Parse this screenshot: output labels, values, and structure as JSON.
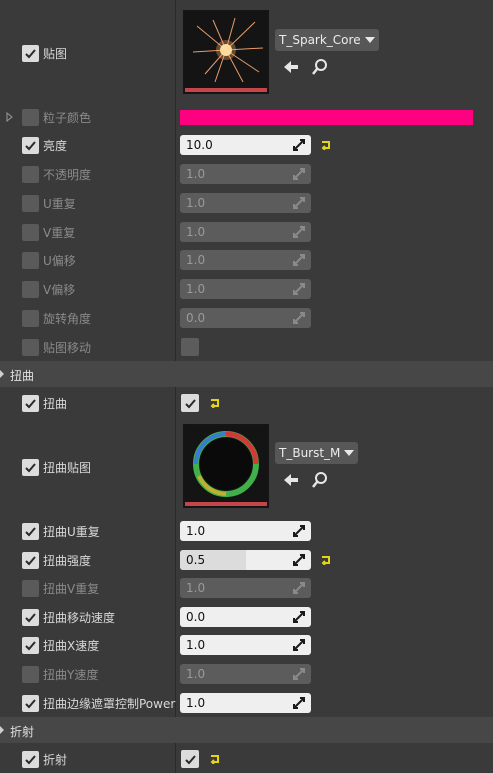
{
  "texture": {
    "label": "贴图",
    "asset": "T_Spark_Core"
  },
  "particle_color": {
    "label": "粒子颜色",
    "color": "#ff0080"
  },
  "brightness": {
    "label": "亮度",
    "value": "10.0"
  },
  "opacity": {
    "label": "不透明度",
    "value": "1.0"
  },
  "u_repeat": {
    "label": "U重复",
    "value": "1.0"
  },
  "v_repeat": {
    "label": "V重复",
    "value": "1.0"
  },
  "u_offset": {
    "label": "U偏移",
    "value": "1.0"
  },
  "v_offset": {
    "label": "V偏移",
    "value": "1.0"
  },
  "rotation": {
    "label": "旋转角度",
    "value": "0.0"
  },
  "texture_move": {
    "label": "贴图移动"
  },
  "distortion_section": {
    "label": "扭曲"
  },
  "distortion": {
    "label": "扭曲"
  },
  "distortion_texture": {
    "label": "扭曲贴图",
    "asset": "T_Burst_M"
  },
  "distortion_u_repeat": {
    "label": "扭曲U重复",
    "value": "1.0"
  },
  "distortion_strength": {
    "label": "扭曲强度",
    "value": "0.5",
    "fill": 0.5
  },
  "distortion_v_repeat": {
    "label": "扭曲V重复",
    "value": "1.0"
  },
  "distortion_move_speed": {
    "label": "扭曲移动速度",
    "value": "0.0"
  },
  "distortion_x_speed": {
    "label": "扭曲X速度",
    "value": "1.0"
  },
  "distortion_y_speed": {
    "label": "扭曲Y速度",
    "value": "1.0"
  },
  "distortion_edge_power": {
    "label": "扭曲边缘遮罩控制Power",
    "value": "1.0"
  },
  "refraction_section": {
    "label": "折射"
  },
  "refraction": {
    "label": "折射"
  },
  "colors": {
    "accent_yellow": "#e5d31a",
    "swatch_pink": "#ff0080",
    "thumb_bar": "#c4464a"
  }
}
